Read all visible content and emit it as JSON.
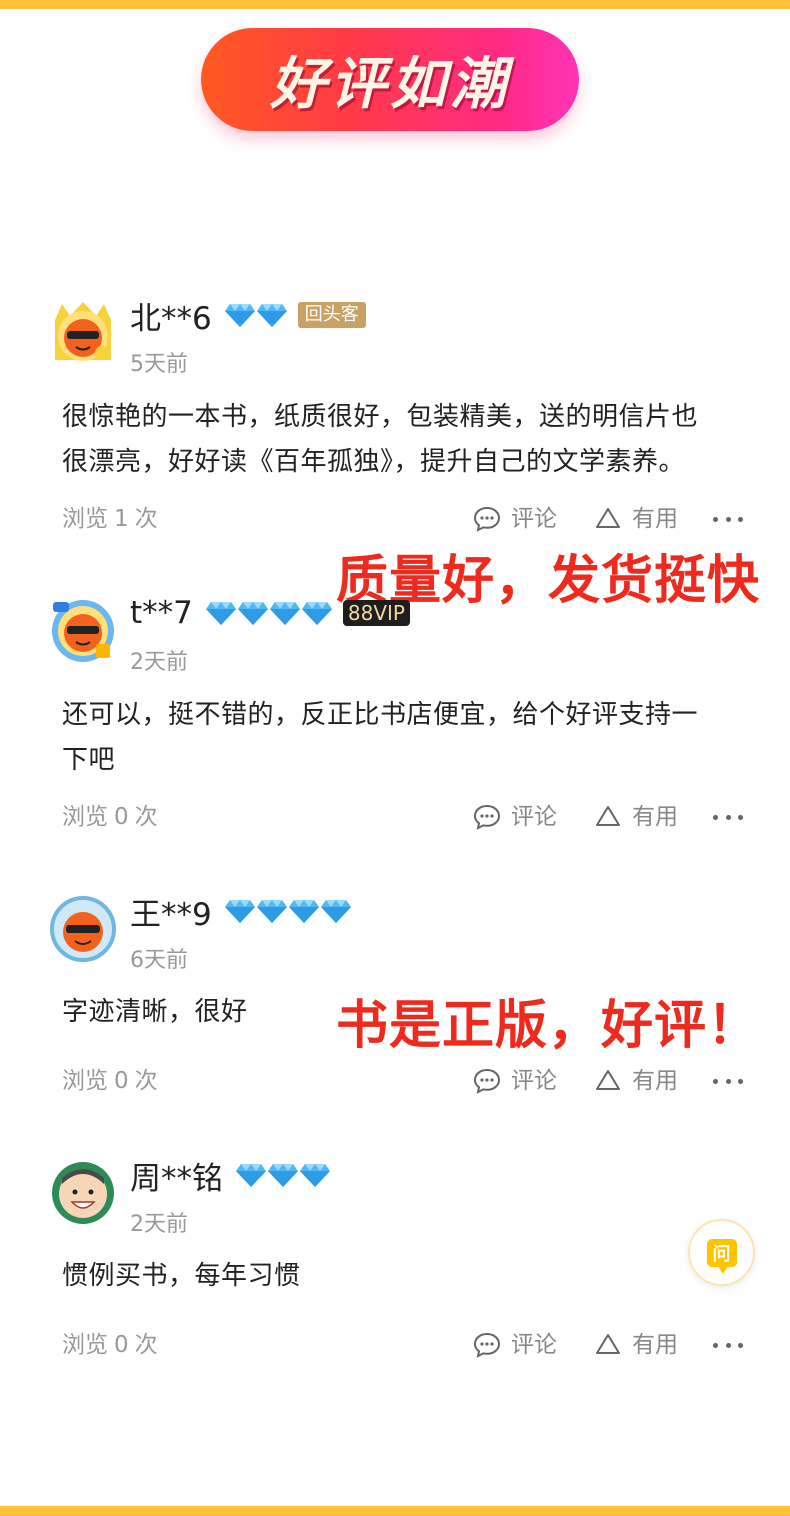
{
  "banner": {
    "title": "好评如潮"
  },
  "overlays": {
    "first": "质量好，发货挺快",
    "second": "书是正版，好评！"
  },
  "colors": {
    "accent_bar": "#FFC23A",
    "overlay_text": "#EE2A1E",
    "banner_gradient_start": "#FF5A1F",
    "banner_gradient_end": "#FF35B8"
  },
  "reviews": [
    {
      "username": "北**6",
      "gem_count": 2,
      "badge": "回头客",
      "time": "5天前",
      "content_lines": [
        "很惊艳的一本书，纸质很好，包装精美，送的明信片也",
        "很漂亮，好好读《百年孤独》，提升自己的文学素养。"
      ],
      "views_label": "浏览",
      "views_count": "1",
      "views_unit": "次",
      "avatar_icon": "orange-mascot-avatar-icon"
    },
    {
      "username": "t**7",
      "gem_count": 4,
      "badge": "88VIP",
      "time": "2天前",
      "content_lines": [
        "还可以，挺不错的，反正比书店便宜，给个好评支持一",
        "下吧"
      ],
      "views_label": "浏览",
      "views_count": "0",
      "views_unit": "次",
      "avatar_icon": "orange-mascot-avatar-icon"
    },
    {
      "username": "王**9",
      "gem_count": 4,
      "badge": "",
      "time": "6天前",
      "content_lines": [
        "字迹清晰，很好"
      ],
      "views_label": "浏览",
      "views_count": "0",
      "views_unit": "次",
      "avatar_icon": "orange-mascot-avatar-icon"
    },
    {
      "username": "周**铭",
      "gem_count": 3,
      "badge": "",
      "time": "2天前",
      "content_lines": [
        "惯例买书，每年习惯"
      ],
      "views_label": "浏览",
      "views_count": "0",
      "views_unit": "次",
      "avatar_icon": "person-avatar-icon"
    }
  ],
  "actions": {
    "comment_label": "评论",
    "useful_label": "有用"
  },
  "ask_button": {
    "label": "问"
  }
}
